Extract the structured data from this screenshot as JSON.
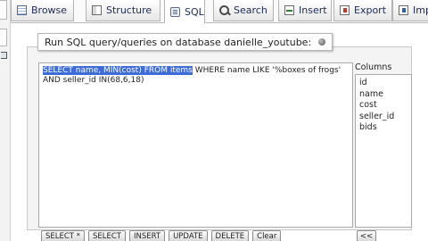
{
  "tabs": [
    {
      "label": "Browse",
      "icon": "browse-icon"
    },
    {
      "label": "Structure",
      "icon": "structure-icon"
    },
    {
      "label": "SQL",
      "icon": "sql-icon",
      "active": true
    },
    {
      "label": "Search",
      "icon": "search-icon"
    },
    {
      "label": "Insert",
      "icon": "insert-icon"
    },
    {
      "label": "Export",
      "icon": "export-icon"
    },
    {
      "label": "Impo",
      "icon": "import-icon"
    }
  ],
  "query_panel": {
    "legend": "Run SQL query/queries on database danielle_youtube:",
    "sql_selected": "SELECT name, MIN(cost) FROM items",
    "sql_rest": " WHERE name LIKE '%boxes of frogs'\nAND seller_id IN(68,6,18)",
    "columns_label": "Columns",
    "columns": [
      "id",
      "name",
      "cost",
      "seller_id",
      "bids"
    ]
  },
  "buttons": {
    "select_star": "SELECT *",
    "select": "SELECT",
    "insert": "INSERT",
    "update": "UPDATE",
    "delete": "DELETE",
    "clear": "Clear",
    "insert_column": "<<"
  },
  "colors": {
    "selection": "#3d6cd9",
    "tab_text": "#1c2a55"
  }
}
